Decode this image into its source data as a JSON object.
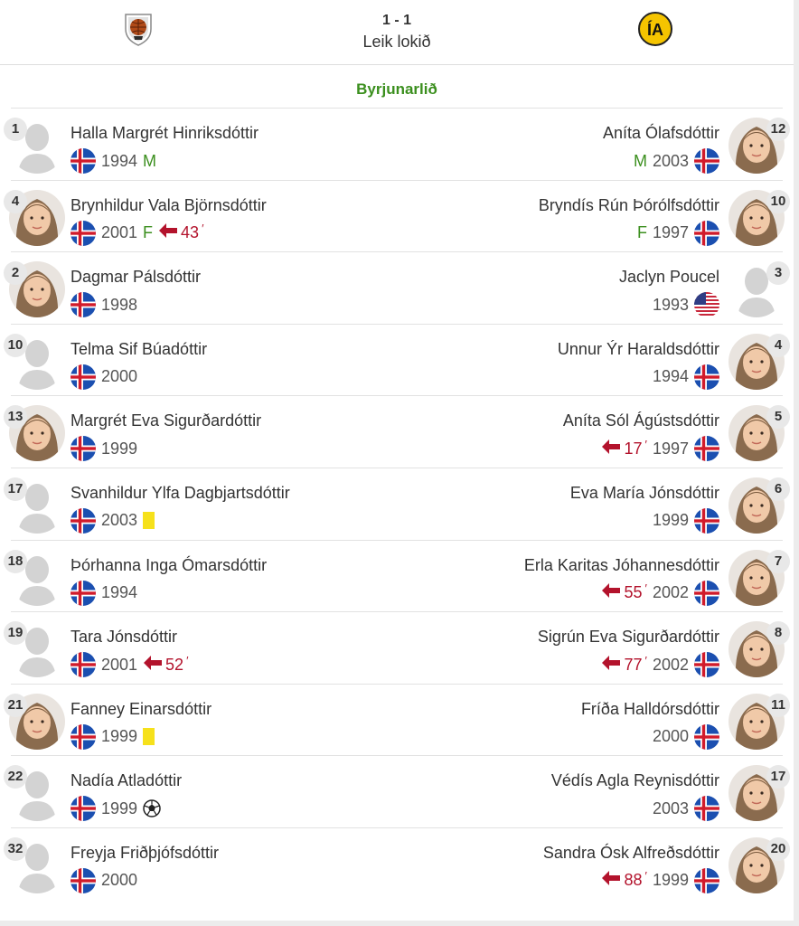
{
  "match": {
    "score": "1 - 1",
    "status": "Leik lokið",
    "home_crest": "home-club-crest",
    "away_crest": "ia-club-crest"
  },
  "section": {
    "title": "Byrjunarlið"
  },
  "colors": {
    "accent_green": "#3b8f1e",
    "sub_red": "#b3132c",
    "card_yellow": "#f6e11b"
  },
  "rows": [
    {
      "home": {
        "number": "1",
        "name": "Halla Margrét Hinriksdóttir",
        "year": "1994",
        "position": "M",
        "photo": false,
        "nation": "iceland",
        "events": []
      },
      "away": {
        "number": "12",
        "name": "Aníta Ólafsdóttir",
        "year": "2003",
        "position": "M",
        "photo": true,
        "nation": "iceland",
        "events": []
      }
    },
    {
      "home": {
        "number": "4",
        "name": "Brynhildur Vala Björnsdóttir",
        "year": "2001",
        "position": "F",
        "photo": true,
        "nation": "iceland",
        "events": [
          {
            "type": "sub",
            "minute": "43"
          }
        ]
      },
      "away": {
        "number": "10",
        "name": "Bryndís Rún Þórólfsdóttir",
        "year": "1997",
        "position": "F",
        "photo": true,
        "nation": "iceland",
        "events": []
      }
    },
    {
      "home": {
        "number": "2",
        "name": "Dagmar Pálsdóttir",
        "year": "1998",
        "position": "",
        "photo": true,
        "nation": "iceland",
        "events": []
      },
      "away": {
        "number": "3",
        "name": "Jaclyn Poucel",
        "year": "1993",
        "position": "",
        "photo": false,
        "nation": "usa",
        "events": []
      }
    },
    {
      "home": {
        "number": "10",
        "name": "Telma Sif Búadóttir",
        "year": "2000",
        "position": "",
        "photo": false,
        "nation": "iceland",
        "events": []
      },
      "away": {
        "number": "4",
        "name": "Unnur Ýr Haraldsdóttir",
        "year": "1994",
        "position": "",
        "photo": true,
        "nation": "iceland",
        "events": []
      }
    },
    {
      "home": {
        "number": "13",
        "name": "Margrét Eva Sigurðardóttir",
        "year": "1999",
        "position": "",
        "photo": true,
        "nation": "iceland",
        "events": []
      },
      "away": {
        "number": "5",
        "name": "Aníta Sól Ágústsdóttir",
        "year": "1997",
        "position": "",
        "photo": true,
        "nation": "iceland",
        "events": [
          {
            "type": "sub",
            "minute": "17"
          }
        ]
      }
    },
    {
      "home": {
        "number": "17",
        "name": "Svanhildur Ylfa Dagbjartsdóttir",
        "year": "2003",
        "position": "",
        "photo": false,
        "nation": "iceland",
        "events": [
          {
            "type": "yellow"
          }
        ]
      },
      "away": {
        "number": "6",
        "name": "Eva María Jónsdóttir",
        "year": "1999",
        "position": "",
        "photo": true,
        "nation": "iceland",
        "events": []
      }
    },
    {
      "home": {
        "number": "18",
        "name": "Þórhanna Inga Ómarsdóttir",
        "year": "1994",
        "position": "",
        "photo": false,
        "nation": "iceland",
        "events": []
      },
      "away": {
        "number": "7",
        "name": "Erla Karitas Jóhannesdóttir",
        "year": "2002",
        "position": "",
        "photo": true,
        "nation": "iceland",
        "events": [
          {
            "type": "sub",
            "minute": "55"
          }
        ]
      }
    },
    {
      "home": {
        "number": "19",
        "name": "Tara Jónsdóttir",
        "year": "2001",
        "position": "",
        "photo": false,
        "nation": "iceland",
        "events": [
          {
            "type": "sub",
            "minute": "52"
          }
        ]
      },
      "away": {
        "number": "8",
        "name": "Sigrún Eva Sigurðardóttir",
        "year": "2002",
        "position": "",
        "photo": true,
        "nation": "iceland",
        "events": [
          {
            "type": "sub",
            "minute": "77"
          }
        ]
      }
    },
    {
      "home": {
        "number": "21",
        "name": "Fanney Einarsdóttir",
        "year": "1999",
        "position": "",
        "photo": true,
        "nation": "iceland",
        "events": [
          {
            "type": "yellow"
          }
        ]
      },
      "away": {
        "number": "11",
        "name": "Fríða Halldórsdóttir",
        "year": "2000",
        "position": "",
        "photo": true,
        "nation": "iceland",
        "events": []
      }
    },
    {
      "home": {
        "number": "22",
        "name": "Nadía Atladóttir",
        "year": "1999",
        "position": "",
        "photo": false,
        "nation": "iceland",
        "events": [
          {
            "type": "goal"
          }
        ]
      },
      "away": {
        "number": "17",
        "name": "Védís Agla Reynisdóttir",
        "year": "2003",
        "position": "",
        "photo": true,
        "nation": "iceland",
        "events": []
      }
    },
    {
      "home": {
        "number": "32",
        "name": "Freyja Friðþjófsdóttir",
        "year": "2000",
        "position": "",
        "photo": false,
        "nation": "iceland",
        "events": []
      },
      "away": {
        "number": "20",
        "name": "Sandra Ósk Alfreðsdóttir",
        "year": "1999",
        "position": "",
        "photo": true,
        "nation": "iceland",
        "events": [
          {
            "type": "sub",
            "minute": "88"
          }
        ]
      }
    }
  ]
}
